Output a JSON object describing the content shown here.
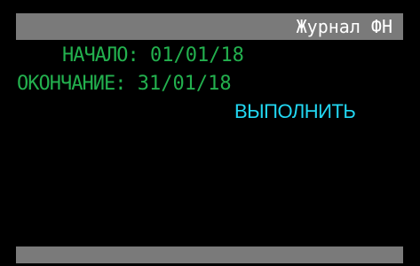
{
  "colors": {
    "background": "#000000",
    "bar": "#7a7a7a",
    "title_text": "#ffffff",
    "field_text": "#23b04e",
    "action_text": "#22d7f2"
  },
  "header": {
    "title": "Журнал ФН"
  },
  "fields": {
    "start_label": "НАЧАЛО:",
    "start_value": "01/01/18",
    "end_label": "ОКОНЧАНИЕ:",
    "end_value": "31/01/18"
  },
  "action": {
    "execute_label": "ВЫПОЛНИТЬ"
  }
}
